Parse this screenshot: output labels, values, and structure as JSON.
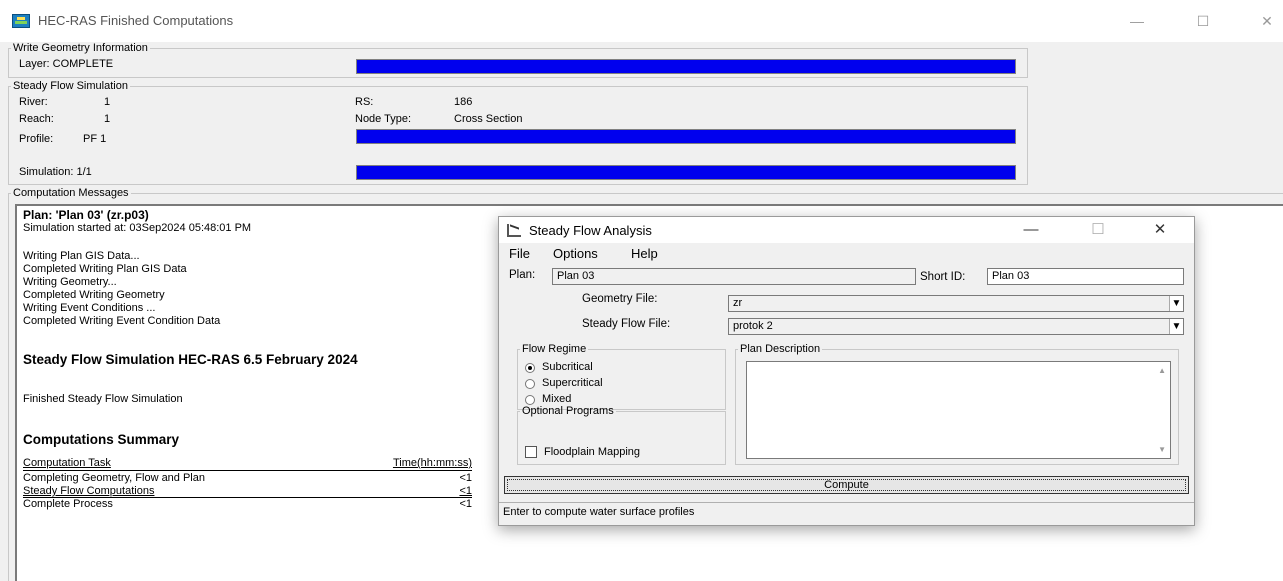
{
  "window": {
    "title": "HEC-RAS Finished Computations",
    "minimize": "—",
    "maximize": "☐",
    "close": "✕"
  },
  "write_geometry": {
    "legend": "Write Geometry Information",
    "layer_label": "Layer: COMPLETE",
    "progress": 1.0
  },
  "steady_sim": {
    "legend": "Steady Flow Simulation",
    "river_label": "River:",
    "river_value": "1",
    "reach_label": "Reach:",
    "reach_value": "1",
    "profile_label": "Profile:",
    "profile_value": "PF 1",
    "rs_label": "RS:",
    "rs_value": "186",
    "node_type_label": "Node Type:",
    "node_type_value": "Cross Section",
    "simulation_label": "Simulation:  1/1",
    "profile_progress": 1.0,
    "simulation_progress": 1.0
  },
  "messages": {
    "legend": "Computation Messages",
    "plan_line": "Plan: 'Plan 03' (zr.p03)",
    "started": "Simulation started at: 03Sep2024 05:48:01 PM",
    "lines": [
      "Writing Plan GIS Data...",
      "Completed Writing Plan GIS Data",
      "Writing Geometry...",
      "Completed Writing Geometry",
      "Writing Event Conditions ...",
      "Completed Writing Event Condition Data"
    ],
    "sim_heading": "Steady Flow Simulation HEC-RAS 6.5 February 2024",
    "finished": "Finished Steady Flow Simulation",
    "summary_heading": "Computations Summary",
    "summary_col_task": "Computation Task",
    "summary_col_time": "Time(hh:mm:ss)",
    "summary_rows": [
      {
        "task": "Completing Geometry, Flow and Plan",
        "time": "<1"
      },
      {
        "task": "Steady Flow Computations",
        "time": "<1"
      },
      {
        "task": "Complete Process",
        "time": "<1"
      }
    ]
  },
  "dialog": {
    "title": "Steady Flow Analysis",
    "minimize": "—",
    "maximize": "☐",
    "close": "✕",
    "menu": [
      "File",
      "Options",
      "Help"
    ],
    "plan_label": "Plan:",
    "plan_value": "Plan 03",
    "short_id_label": "Short ID:",
    "short_id_value": "Plan 03",
    "geometry_label": "Geometry File:",
    "geometry_value": "zr",
    "flow_file_label": "Steady Flow File:",
    "flow_file_value": "protok 2",
    "flow_regime_legend": "Flow Regime",
    "regimes": [
      "Subcritical",
      "Supercritical",
      "Mixed"
    ],
    "selected_regime": "Subcritical",
    "optional_legend": "Optional Programs",
    "floodplain_label": "Floodplain Mapping",
    "floodplain_checked": false,
    "plan_desc_legend": "Plan Description",
    "plan_desc_value": "",
    "compute_label": "Compute",
    "status": "Enter to compute water surface profiles"
  }
}
